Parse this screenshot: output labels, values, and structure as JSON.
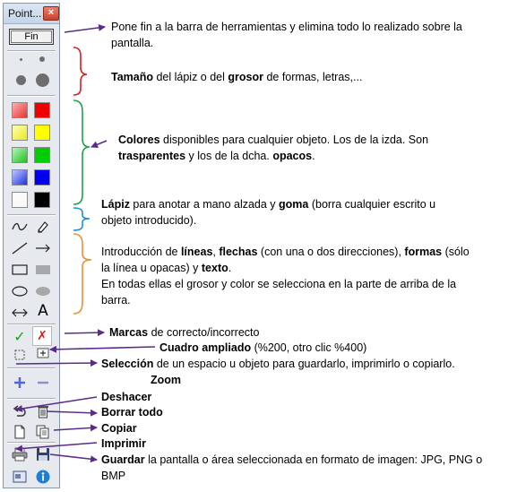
{
  "toolbar": {
    "title": "Point...",
    "close_glyph": "×",
    "fin_label": "Fin",
    "pen_sizes": [
      "small-dot",
      "medium-dot",
      "large-dot",
      "xlarge-dot"
    ],
    "color_columns": {
      "transparent": [
        "#f44a4a",
        "#f0f048",
        "#46d246",
        "#4a5cf0",
        "#f8f8f8"
      ],
      "opaque": [
        "#ee0000",
        "#ffff00",
        "#00cc00",
        "#0000ee",
        "#000000"
      ]
    },
    "text_tool_label": "A",
    "check_glyph": "✓",
    "cross_glyph": "✗",
    "icons": [
      "pencil-icon",
      "eraser-icon",
      "line-icon",
      "arrow-icon",
      "double-arrow-icon",
      "text-icon",
      "rect-outline-icon",
      "rect-filled-icon",
      "ellipse-outline-icon",
      "ellipse-filled-icon",
      "correct-icon",
      "incorrect-icon",
      "select-icon",
      "zoom-box-icon",
      "zoom-in-icon",
      "zoom-out-icon",
      "undo-icon",
      "trash-icon",
      "document-icon",
      "copy-icon",
      "print-icon",
      "save-icon",
      "screen-icon",
      "info-icon"
    ]
  },
  "annotations": {
    "fin": {
      "line1": "Pone fin a la barra de herramientas y elimina todo lo realizado sobre la",
      "line2": "pantalla."
    },
    "size": {
      "b1": "Tamaño",
      "t1": " del lápiz o del ",
      "b2": "grosor",
      "t2": " de formas, letras,..."
    },
    "colors": {
      "b1": "Colores",
      "t1": " disponibles para cualquier objeto. Los de la izda. Son",
      "b2": "trasparentes",
      "t2": " y los de la dcha. ",
      "b3": "opacos",
      "t3": "."
    },
    "pen": {
      "b1": "Lápiz",
      "t1": " para anotar a mano alzada y ",
      "b2": "goma",
      "t2": " (borra cualquier escrito u",
      "line2": "objeto introducido)."
    },
    "shapes": {
      "t1": "Introducción de ",
      "b1": "líneas",
      "t2": ", ",
      "b2": "flechas",
      "t3": " (con una o dos direcciones), ",
      "b3": "formas",
      "t4": " (sólo",
      "t5": "la línea u opacas) y ",
      "b4": "texto",
      "t6": ".",
      "line3": "En todas ellas el grosor y color se selecciona en la parte de arriba de la",
      "line4": "barra."
    },
    "marks": {
      "b1": "Marcas",
      "t1": " de correcto/incorrecto"
    },
    "zoom_box": {
      "b1": "Cuadro ampliado",
      "t1": " (%200, otro clic %400)"
    },
    "selection": {
      "b1": "Selección",
      "t1": " de un espacio u objeto para guardarlo, imprimirlo o copiarlo."
    },
    "zoom": "Zoom",
    "undo": "Deshacer",
    "clear": "Borrar todo",
    "copy": "Copiar",
    "print": "Imprimir",
    "save": {
      "b1": "Guardar",
      "t1": " la pantalla o área seleccionada en formato de imagen: JPG, PNG o",
      "line2": "BMP"
    }
  },
  "colors": {
    "arrow": "#5b2b8c",
    "brace_red": "#d42020",
    "brace_green": "#21a04c",
    "brace_blue": "#1e8fd8",
    "brace_orange": "#e8923a"
  }
}
